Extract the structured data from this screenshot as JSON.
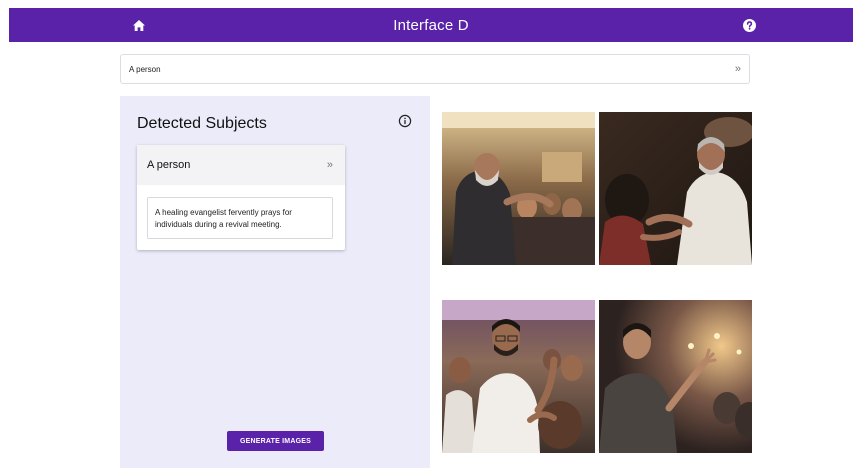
{
  "colors": {
    "brand": "#5a22a8",
    "panel_bg": "#ebebfa"
  },
  "header": {
    "title": "Interface D",
    "left_icon": "home-icon",
    "right_icon": "help-icon"
  },
  "prompt_bar": {
    "value": "A person",
    "expand_icon": "chevron-double-right-icon"
  },
  "panel": {
    "title": "Detected Subjects",
    "info_icon": "info-icon",
    "subjects": [
      {
        "label": "A person",
        "description": "A healing evangelist fervently prays for individuals during a revival meeting."
      }
    ],
    "generate_label": "GENERATE IMAGES"
  }
}
